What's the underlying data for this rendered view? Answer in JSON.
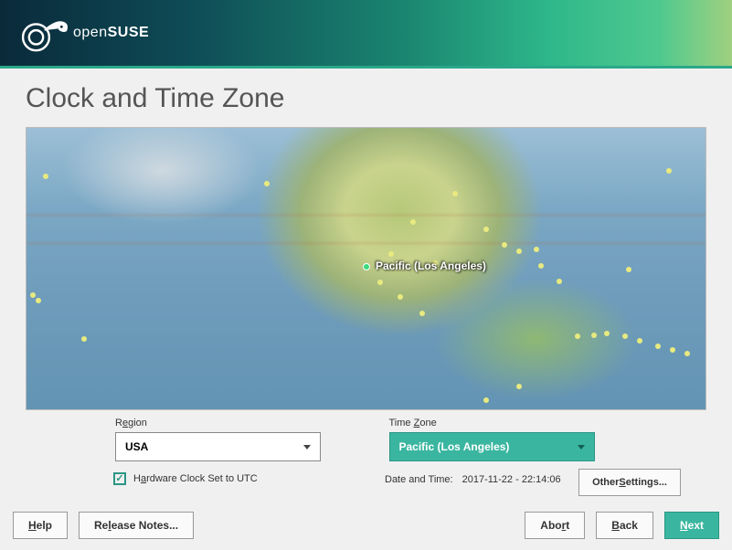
{
  "brand": {
    "name_light": "open",
    "name_bold": "SUSE"
  },
  "page": {
    "title": "Clock and Time Zone"
  },
  "map": {
    "selected_label": "Pacific (Los Angeles)"
  },
  "region": {
    "label_pre": "R",
    "label_ul": "e",
    "label_post": "gion",
    "value": "USA"
  },
  "timezone": {
    "label_pre": "Time ",
    "label_ul": "Z",
    "label_post": "one",
    "value": "Pacific (Los Angeles)"
  },
  "hwclock": {
    "label_pre": "H",
    "label_ul": "a",
    "label_post": "rdware Clock Set to UTC",
    "checked": true
  },
  "datetime": {
    "label": "Date and Time:",
    "value": "2017-11-22 - 22:14:06"
  },
  "buttons": {
    "other_pre": "Other ",
    "other_ul": "S",
    "other_post": "ettings...",
    "help_ul": "H",
    "help_post": "elp",
    "release_pre": "Re",
    "release_ul": "l",
    "release_post": "ease Notes...",
    "abort_pre": "Abo",
    "abort_ul": "r",
    "abort_post": "t",
    "back_ul": "B",
    "back_post": "ack",
    "next_ul": "N",
    "next_post": "ext"
  }
}
